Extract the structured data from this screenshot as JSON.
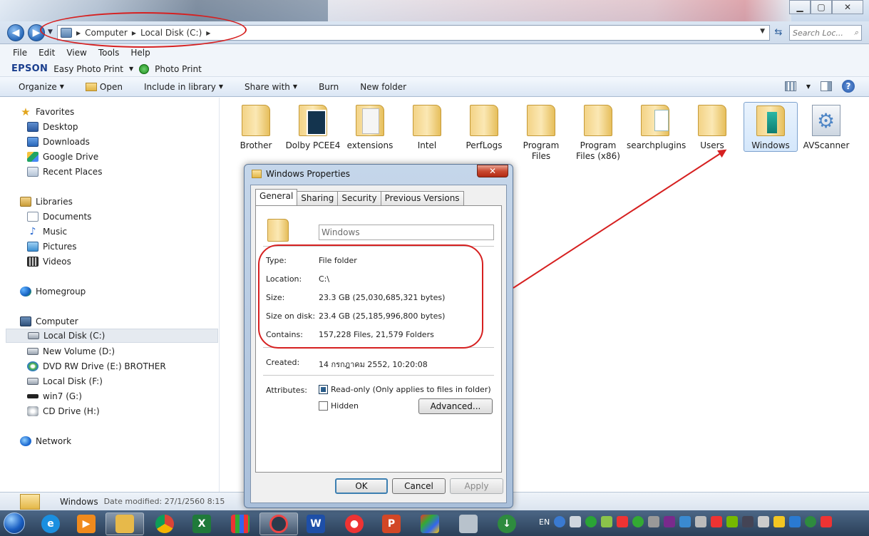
{
  "window": {
    "breadcrumb": [
      "Computer",
      "Local Disk (C:)"
    ],
    "search_placeholder": "Search Loc...",
    "min_glyph": "▁",
    "max_glyph": "▢",
    "close_glyph": "✕"
  },
  "menu": [
    "File",
    "Edit",
    "View",
    "Tools",
    "Help"
  ],
  "epson": {
    "logo": "EPSON",
    "easy_photo_print": "Easy Photo Print",
    "photo_print": "Photo Print"
  },
  "toolbar": {
    "organize": "Organize",
    "open": "Open",
    "include_in_library": "Include in library",
    "share_with": "Share with",
    "burn": "Burn",
    "new_folder": "New folder"
  },
  "nav": {
    "favorites": "Favorites",
    "desktop": "Desktop",
    "downloads": "Downloads",
    "google_drive": "Google Drive",
    "recent_places": "Recent Places",
    "libraries": "Libraries",
    "documents": "Documents",
    "music": "Music",
    "pictures": "Pictures",
    "videos": "Videos",
    "homegroup": "Homegroup",
    "computer": "Computer",
    "local_c": "Local Disk (C:)",
    "new_volume_d": "New Volume (D:)",
    "dvd_e": "DVD RW Drive (E:) BROTHER",
    "local_f": "Local Disk (F:)",
    "win7_g": "win7 (G:)",
    "cd_h": "CD Drive (H:)",
    "network": "Network"
  },
  "files": [
    {
      "name": "Brother"
    },
    {
      "name": "Dolby PCEE4"
    },
    {
      "name": "extensions"
    },
    {
      "name": "Intel"
    },
    {
      "name": "PerfLogs"
    },
    {
      "name": "Program Files"
    },
    {
      "name": "Program Files (x86)"
    },
    {
      "name": "searchplugins"
    },
    {
      "name": "Users"
    },
    {
      "name": "Windows"
    },
    {
      "name": "AVScanner"
    }
  ],
  "status": {
    "name": "Windows",
    "meta": "Date modified: 27/1/2560 8:15"
  },
  "taskbar": {
    "lang": "EN"
  },
  "dialog": {
    "title": "Windows Properties",
    "tabs": [
      "General",
      "Sharing",
      "Security",
      "Previous Versions"
    ],
    "name_value": "Windows",
    "props": {
      "type_label": "Type:",
      "type": "File folder",
      "location_label": "Location:",
      "location": "C:\\",
      "size_label": "Size:",
      "size": "23.3 GB (25,030,685,321 bytes)",
      "size_on_disk_label": "Size on disk:",
      "size_on_disk": "23.4 GB (25,185,996,800 bytes)",
      "contains_label": "Contains:",
      "contains": "157,228 Files, 21,579 Folders",
      "created_label": "Created:",
      "created": "14 กรกฎาคม 2552, 10:20:08",
      "attributes_label": "Attributes:",
      "readonly": "Read-only (Only applies to files in folder)",
      "hidden": "Hidden"
    },
    "buttons": {
      "advanced": "Advanced...",
      "ok": "OK",
      "cancel": "Cancel",
      "apply": "Apply"
    }
  },
  "colors": {
    "annotation": "#d62020",
    "selection": "#d4e7fb"
  }
}
